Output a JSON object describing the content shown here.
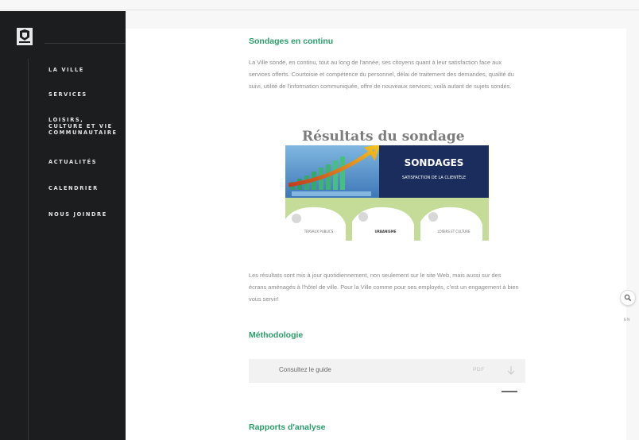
{
  "nav": {
    "items": [
      "La Ville",
      "Services",
      "Loisirs, culture et vie communautaire",
      "Actualités",
      "Calendrier",
      "Nous joindre"
    ]
  },
  "section1": {
    "title": "Sondages en continu",
    "text": "La Ville sonde, en continu, tout au long de l'année, ses citoyens quant à leur satisfaction face aux services offerts. Courtoisie et compétence du personnel, délai de traitement des demandes, qualité du suivi, utilité de l'information communiquée, offre de nouveaux services; voilà autant de sujets sondés."
  },
  "results": {
    "title": "Résultats du sondage",
    "banner_title": "SONDAGES",
    "banner_subtitle": "SATISFACTION DE LA CLIENTÈLE",
    "cards": [
      "TRAVAUX PUBLICS",
      "URBANISME",
      "LOISIRS ET CULTURE"
    ]
  },
  "section2": {
    "text": "Les résultats sont mis à jour quotidiennement, non seulement sur le site Web, mais aussi sur des écrans aménagés à l'hôtel de ville. Pour la Ville comme pour ses employés, c'est un engagement à bien vous servir!"
  },
  "methodology": {
    "title": "Méthodologie",
    "guide_label": "Consultez le guide",
    "guide_type": "PDF"
  },
  "reports": {
    "title": "Rapports d'analyse"
  },
  "lang": "EN",
  "colors": {
    "accent": "#2a9d6a",
    "sidebar": "#1c1d1f",
    "banner_navy": "#1b2d5c"
  }
}
